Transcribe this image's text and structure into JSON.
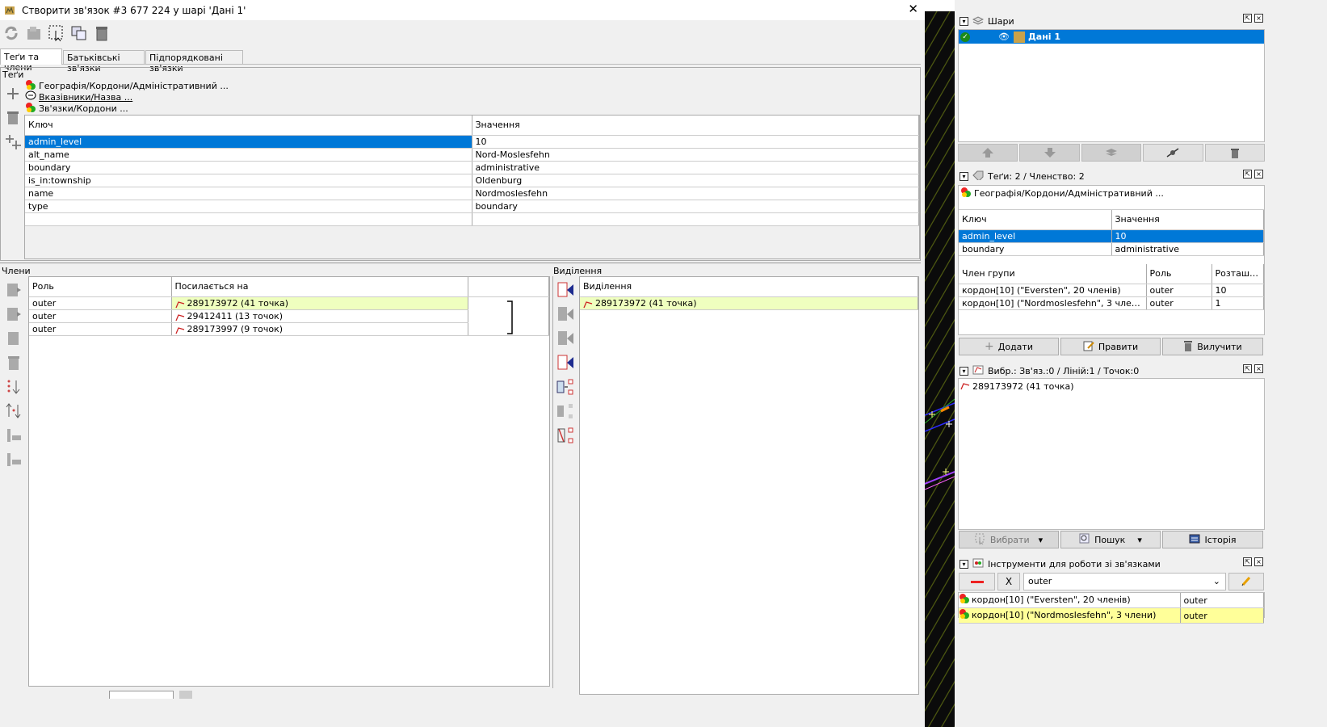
{
  "dialog": {
    "title": "Створити зв'язок #3 677 224 у шарі 'Дані 1'",
    "close": "✕",
    "tabs": [
      "Теґи та члени",
      "Батьківські зв'язки",
      "Підпорядковані зв'язки"
    ],
    "tags_label": "Теґи",
    "presets": [
      "Географія/Кордони/Адміністративний ...",
      "Вказівники/Назва ...",
      "Зв'язки/Кордони ..."
    ],
    "tag_headers": {
      "key": "Ключ",
      "value": "Значення"
    },
    "tags": [
      {
        "k": "admin_level",
        "v": "10"
      },
      {
        "k": "alt_name",
        "v": "Nord-Moslesfehn"
      },
      {
        "k": "boundary",
        "v": "administrative"
      },
      {
        "k": "is_in:township",
        "v": "Oldenburg"
      },
      {
        "k": "name",
        "v": "Nordmoslesfehn"
      },
      {
        "k": "type",
        "v": "boundary"
      }
    ],
    "members_label": "Члени",
    "member_headers": {
      "role": "Роль",
      "ref": "Посилається на"
    },
    "members": [
      {
        "role": "outer",
        "ref": "289173972 (41 точка)"
      },
      {
        "role": "outer",
        "ref": "29412411 (13 точок)"
      },
      {
        "role": "outer",
        "ref": "289173997 (9 точок)"
      }
    ],
    "selection_label": "Виділення",
    "selection_header": "Виділення",
    "selection": [
      "289173972 (41 точка)"
    ]
  },
  "right": {
    "layers": {
      "title": "Шари",
      "item": "Дані 1"
    },
    "tags_panel": {
      "title": "Теґи: 2 / Членство: 2",
      "preset": "Географія/Кордони/Адміністративний ...",
      "headers": {
        "key": "Ключ",
        "value": "Значення"
      },
      "rows": [
        {
          "k": "admin_level",
          "v": "10"
        },
        {
          "k": "boundary",
          "v": "administrative"
        }
      ],
      "member_headers": {
        "group": "Член групи",
        "role": "Роль",
        "pos": "Розташу..."
      },
      "members": [
        {
          "g": "кордон[10] (\"Eversten\", 20 членів)",
          "r": "outer",
          "p": "10"
        },
        {
          "g": "кордон[10] (\"Nordmoslesfehn\", 3 члени)",
          "r": "outer",
          "p": "1"
        }
      ],
      "buttons": {
        "add": "Додати",
        "edit": "Правити",
        "del": "Вилучити"
      }
    },
    "selection_panel": {
      "title": "Вибр.: Зв'яз.:0 / Ліній:1 / Точок:0",
      "item": "289173972 (41 точка)",
      "buttons": {
        "select": "Вибрати",
        "search": "Пошук",
        "history": "Історія"
      }
    },
    "relation_tools": {
      "title": "Інструменти для роботи зі зв'язками",
      "x": "X",
      "role": "outer",
      "rows": [
        {
          "name": "кордон[10] (\"Eversten\", 20 членів)",
          "role": "outer"
        },
        {
          "name": "кордон[10] (\"Nordmoslesfehn\", 3 члени)",
          "role": "outer"
        }
      ]
    }
  }
}
